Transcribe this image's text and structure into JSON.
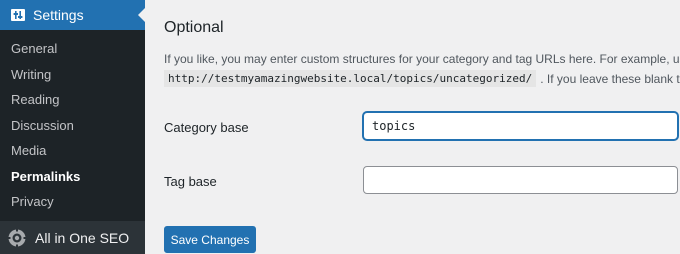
{
  "sidebar": {
    "settings_label": "Settings",
    "items": [
      {
        "label": "General"
      },
      {
        "label": "Writing"
      },
      {
        "label": "Reading"
      },
      {
        "label": "Discussion"
      },
      {
        "label": "Media"
      },
      {
        "label": "Permalinks",
        "current": true
      },
      {
        "label": "Privacy"
      }
    ],
    "aioseo_label": "All in One SEO"
  },
  "main": {
    "heading": "Optional",
    "description_line1": "If you like, you may enter custom structures for your category and tag URLs here. For example, using",
    "code_example": "http://testmyamazingwebsite.local/topics/uncategorized/",
    "description_line2_tail": ". If you leave these blank the d",
    "category_base": {
      "label": "Category base",
      "value": "topics"
    },
    "tag_base": {
      "label": "Tag base",
      "value": ""
    },
    "save_label": "Save Changes"
  },
  "colors": {
    "sidebar_bg": "#1d2327",
    "accent": "#2271b1",
    "page_bg": "#f0f0f1"
  },
  "icons": {
    "settings": "settings-sliders-icon",
    "aioseo": "aioseo-gear-icon"
  }
}
